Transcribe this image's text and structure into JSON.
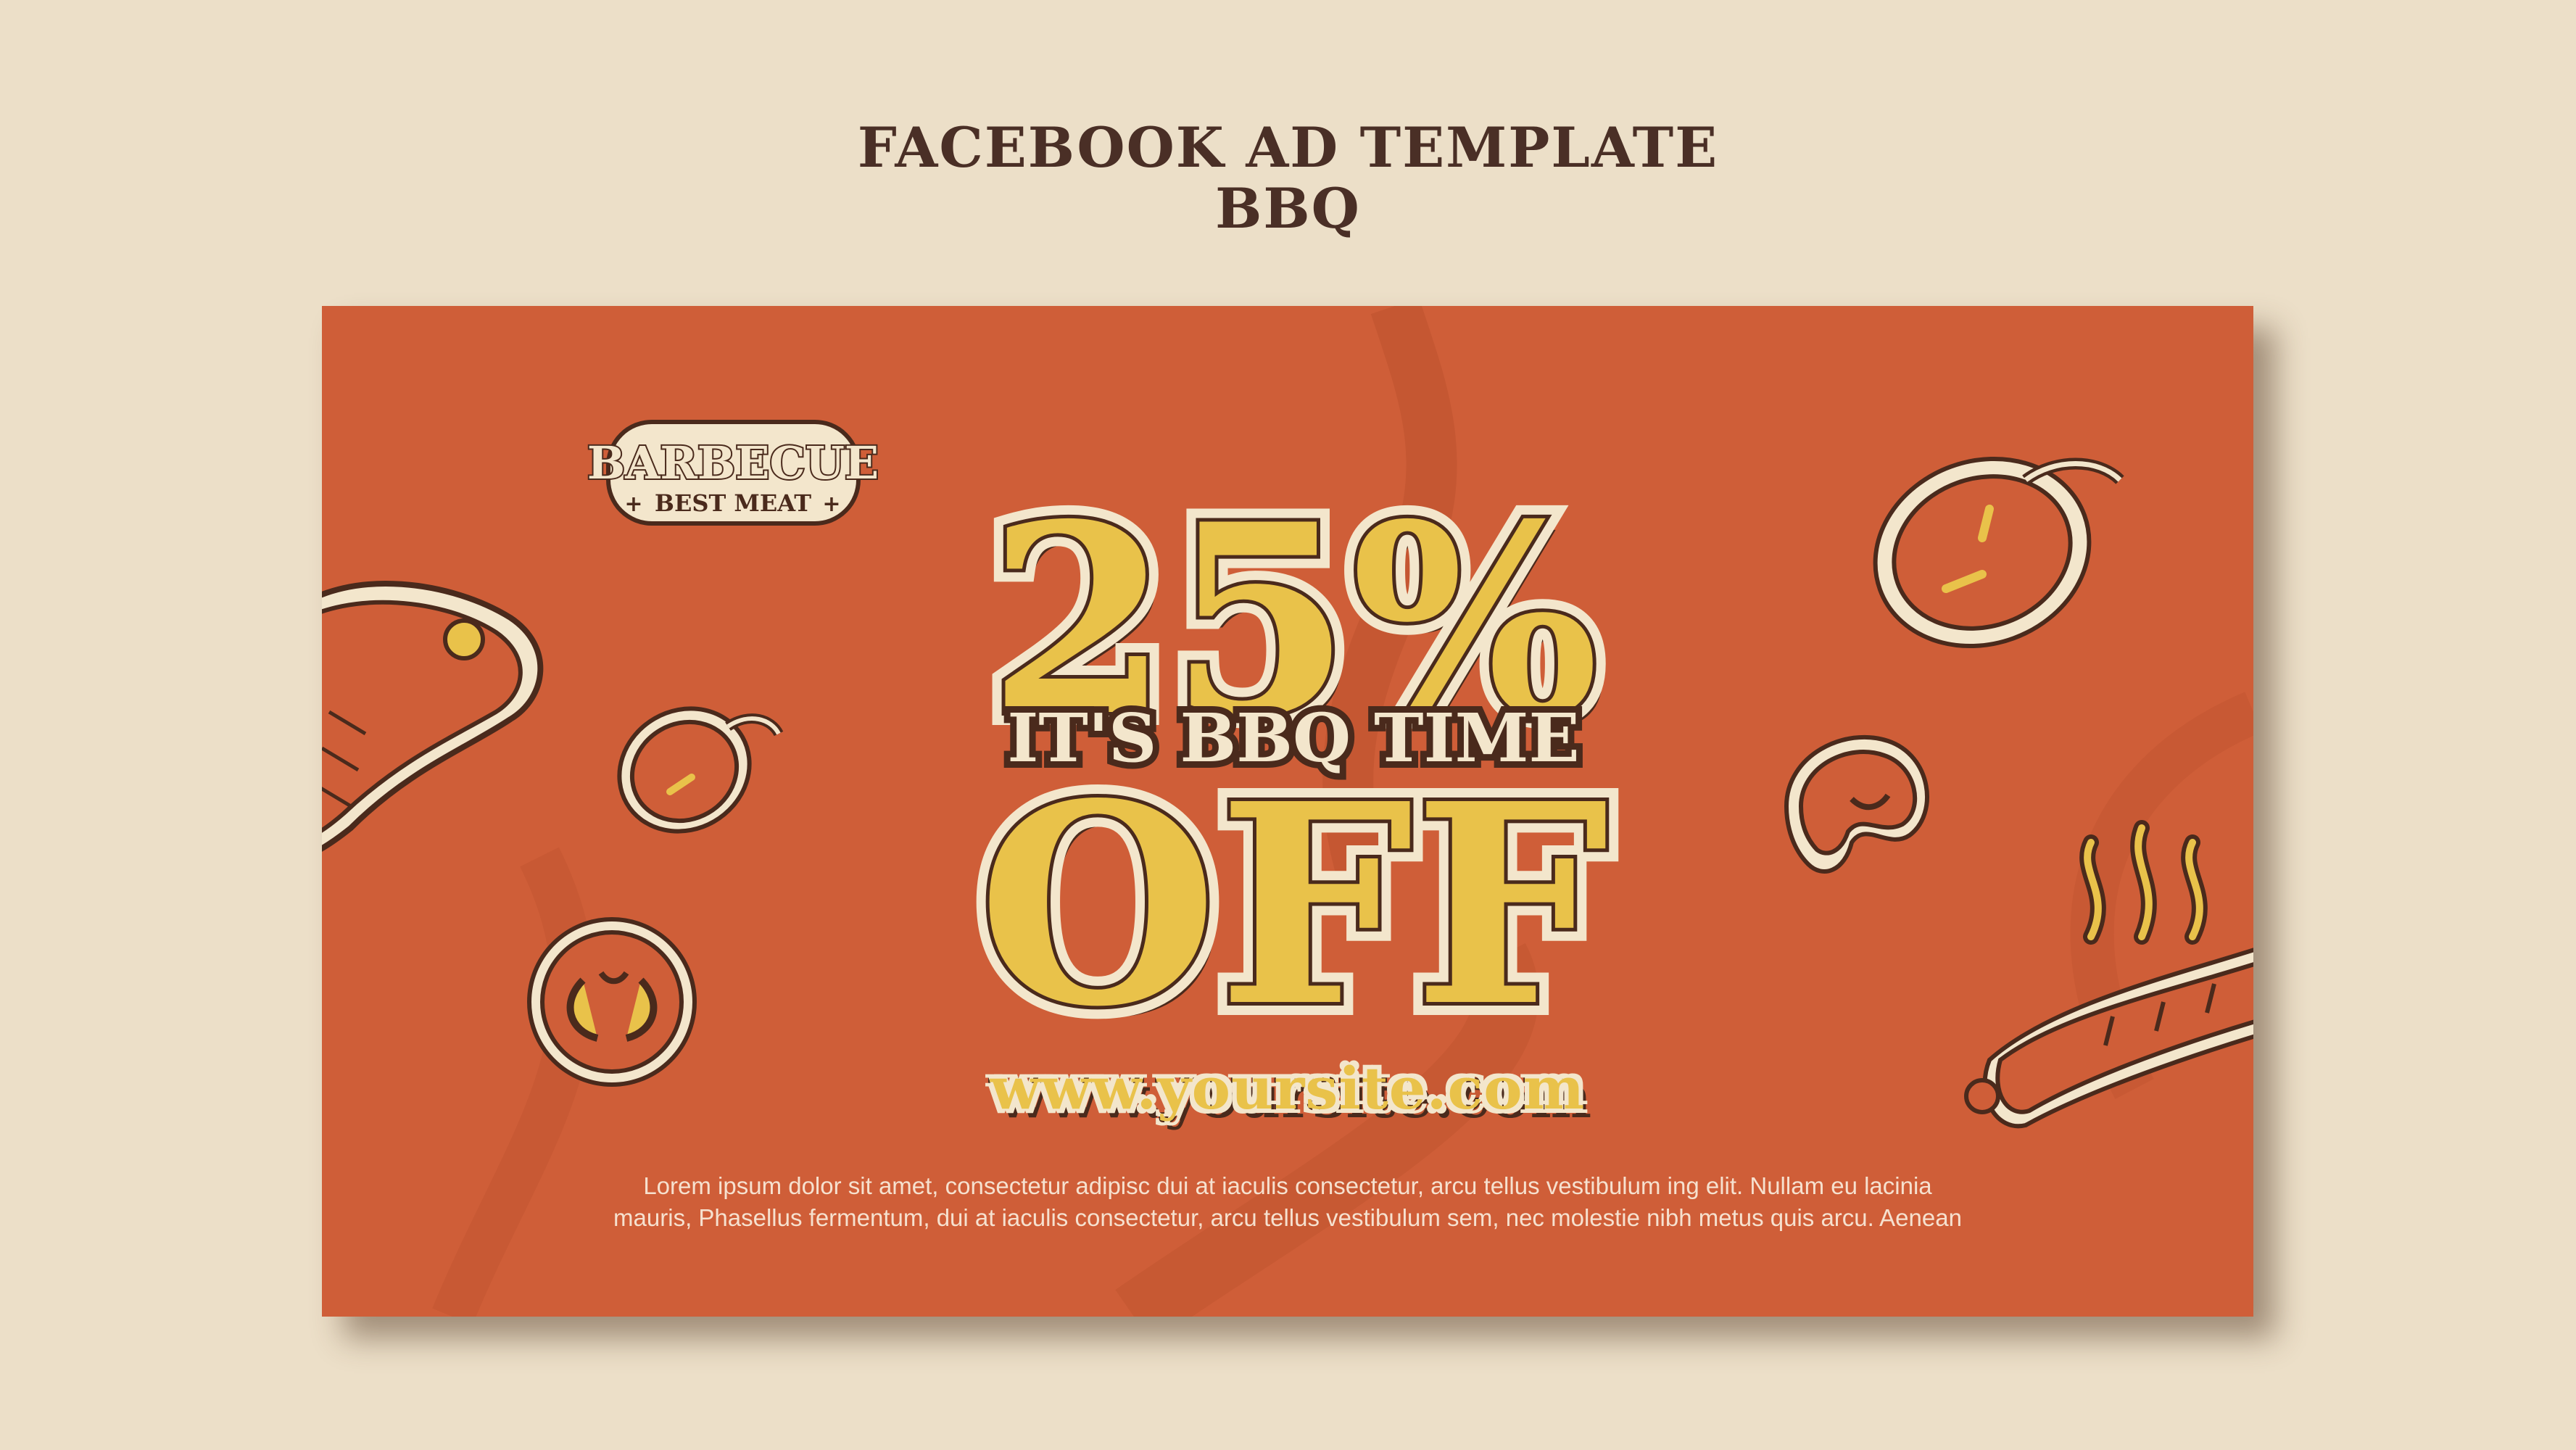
{
  "header": {
    "line1": "FACEBOOK AD TEMPLATE",
    "line2": "BBQ"
  },
  "banner": {
    "badge_top": "BARBECUE",
    "badge_bottom": "BEST MEAT",
    "discount": "25%",
    "tagline": "IT'S BBQ TIME",
    "off": "OFF",
    "url": "www.yoursite.com",
    "body_line1": "Lorem ipsum dolor sit amet, consectetur adipisc dui at iaculis consectetur, arcu tellus vestibulum  ing elit. Nullam eu lacinia",
    "body_line2": "mauris, Phasellus fermentum, dui at iaculis consectetur, arcu tellus vestibulum sem, nec molestie nibh metus quis arcu. Aenean"
  },
  "icons": [
    "steak-icon",
    "pepper-icon",
    "tomato-slice-icon",
    "mushroom-icon",
    "sausage-icon",
    "steam-icon"
  ],
  "colors": {
    "background": "#ecdfc8",
    "banner": "#cf5e38",
    "accent_yellow": "#e9c24a",
    "outline_brown": "#4a2a1c",
    "cream": "#f3e6cc"
  }
}
